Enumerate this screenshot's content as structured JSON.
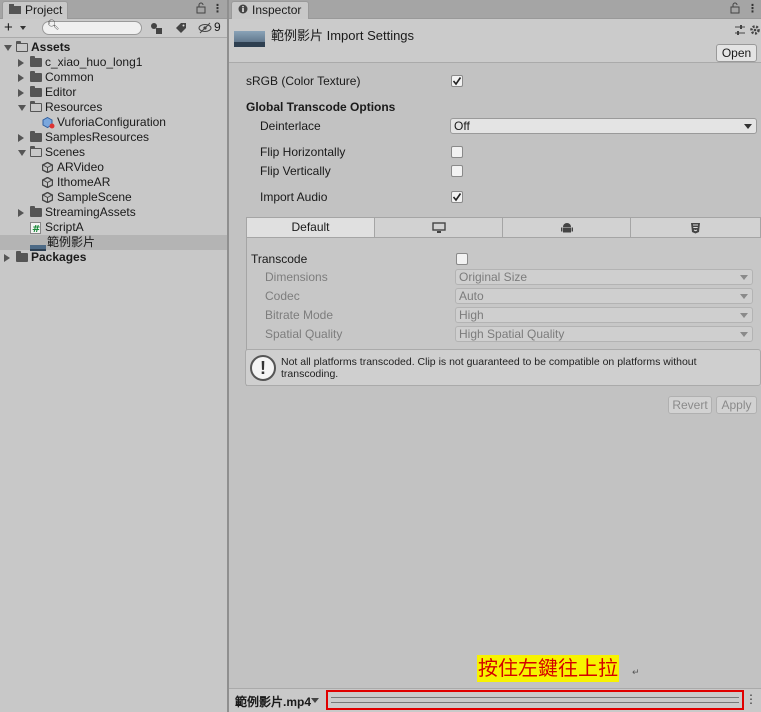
{
  "project": {
    "tab_label": "Project",
    "hidden_count": "9",
    "tree": [
      {
        "label": "Assets",
        "depth": 0,
        "expand": "down",
        "icon": "folder-open-icon",
        "bold": true
      },
      {
        "label": "c_xiao_huo_long1",
        "depth": 1,
        "expand": "right",
        "icon": "folder-icon"
      },
      {
        "label": "Common",
        "depth": 1,
        "expand": "right",
        "icon": "folder-icon"
      },
      {
        "label": "Editor",
        "depth": 1,
        "expand": "right",
        "icon": "folder-icon"
      },
      {
        "label": "Resources",
        "depth": 1,
        "expand": "down",
        "icon": "folder-open-icon"
      },
      {
        "label": "VuforiaConfiguration",
        "depth": 2,
        "expand": "none",
        "icon": "config-icon"
      },
      {
        "label": "SamplesResources",
        "depth": 1,
        "expand": "right",
        "icon": "folder-icon"
      },
      {
        "label": "Scenes",
        "depth": 1,
        "expand": "down",
        "icon": "folder-open-icon"
      },
      {
        "label": "ARVideo",
        "depth": 2,
        "expand": "none",
        "icon": "unity-scene-icon"
      },
      {
        "label": "IthomeAR",
        "depth": 2,
        "expand": "none",
        "icon": "unity-scene-icon"
      },
      {
        "label": "SampleScene",
        "depth": 2,
        "expand": "none",
        "icon": "unity-scene-icon"
      },
      {
        "label": "StreamingAssets",
        "depth": 1,
        "expand": "right",
        "icon": "folder-icon"
      },
      {
        "label": "ScriptA",
        "depth": 1,
        "expand": "none",
        "icon": "script-icon"
      },
      {
        "label": "範例影片",
        "depth": 1,
        "expand": "none",
        "icon": "video-clip-icon",
        "selected": true
      },
      {
        "label": "Packages",
        "depth": 0,
        "expand": "right",
        "icon": "folder-icon",
        "bold": true
      }
    ]
  },
  "inspector": {
    "tab_label": "Inspector",
    "title": "範例影片 Import Settings",
    "open_button": "Open",
    "srgb_label": "sRGB (Color Texture)",
    "srgb_checked": true,
    "global_options_heading": "Global Transcode Options",
    "deinterlace_label": "Deinterlace",
    "deinterlace_value": "Off",
    "flip_h_label": "Flip Horizontally",
    "flip_h_checked": false,
    "flip_v_label": "Flip Vertically",
    "flip_v_checked": false,
    "import_audio_label": "Import Audio",
    "import_audio_checked": true,
    "platform_tabs": [
      {
        "label": "Default",
        "icon": "",
        "active": true
      },
      {
        "label": "",
        "icon": "monitor-icon",
        "active": false
      },
      {
        "label": "",
        "icon": "android-icon",
        "active": false
      },
      {
        "label": "",
        "icon": "html5-icon",
        "active": false
      }
    ],
    "transcode_label": "Transcode",
    "transcode_checked": false,
    "dimensions_label": "Dimensions",
    "dimensions_value": "Original Size",
    "codec_label": "Codec",
    "codec_value": "Auto",
    "bitrate_label": "Bitrate Mode",
    "bitrate_value": "High",
    "spatial_label": "Spatial Quality",
    "spatial_value": "High Spatial Quality",
    "help_text": "Not all platforms transcoded. Clip is not guaranteed to be compatible on platforms without transcoding.",
    "revert_button": "Revert",
    "apply_button": "Apply"
  },
  "bottom": {
    "asset_name": "範例影片.mp4",
    "annotation": "按住左鍵往上拉"
  },
  "colors": {
    "highlight_border": "#e00000",
    "annotation_bg": "#f7f300",
    "annotation_text": "#d40000"
  }
}
